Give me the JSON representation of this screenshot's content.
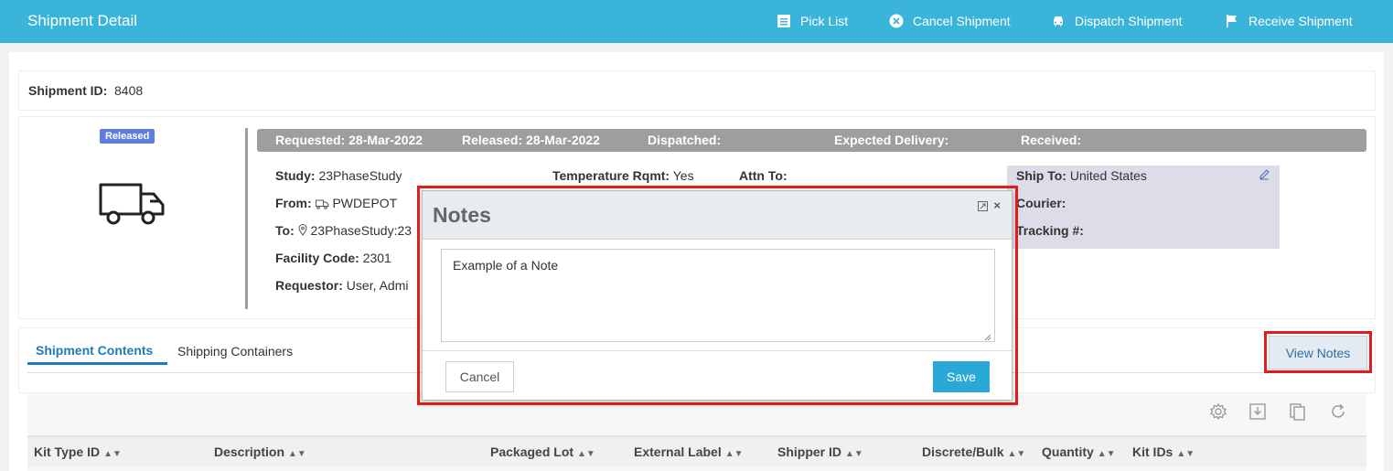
{
  "header": {
    "title": "Shipment Detail",
    "actions": {
      "pick_list": "Pick List",
      "cancel_shipment": "Cancel Shipment",
      "dispatch_shipment": "Dispatch Shipment",
      "receive_shipment": "Receive Shipment"
    }
  },
  "shipment": {
    "id_label": "Shipment ID:",
    "id_value": "8408",
    "status_badge": "Released"
  },
  "status_bar": {
    "requested": "Requested: 28-Mar-2022",
    "released": "Released: 28-Mar-2022",
    "dispatched": "Dispatched:",
    "expected_delivery": "Expected Delivery:",
    "received": "Received:"
  },
  "details": {
    "study_label": "Study:",
    "study_value": "23PhaseStudy",
    "from_label": "From:",
    "from_value": "PWDEPOT",
    "to_label": "To:",
    "to_value": "23PhaseStudy:23",
    "facility_code_label": "Facility Code:",
    "facility_code_value": "2301",
    "requestor_label": "Requestor:",
    "requestor_value": "User, Admi",
    "temp_label": "Temperature Rqmt:",
    "temp_value": "Yes",
    "attn_label": "Attn To:"
  },
  "ship_to": {
    "ship_to_label": "Ship To:",
    "ship_to_value": "United States",
    "courier_label": "Courier:",
    "tracking_label": "Tracking #:"
  },
  "tabs": {
    "shipment_contents": "Shipment Contents",
    "shipping_containers": "Shipping Containers"
  },
  "view_notes_label": "View Notes",
  "table": {
    "columns": [
      "Kit Type ID",
      "Description",
      "Packaged Lot",
      "External Label",
      "Shipper ID",
      "Discrete/Bulk",
      "Quantity",
      "Kit IDs"
    ]
  },
  "modal": {
    "title": "Notes",
    "note_text": "Example of a Note",
    "cancel_label": "Cancel",
    "save_label": "Save"
  },
  "colors": {
    "header_bg": "#3ab4d9",
    "status_bar_bg": "#9e9e9e",
    "badge_bg": "#5b7fe0",
    "tab_active": "#1e7bb8",
    "save_button": "#2aa8d8",
    "highlight": "#e21b1b"
  }
}
